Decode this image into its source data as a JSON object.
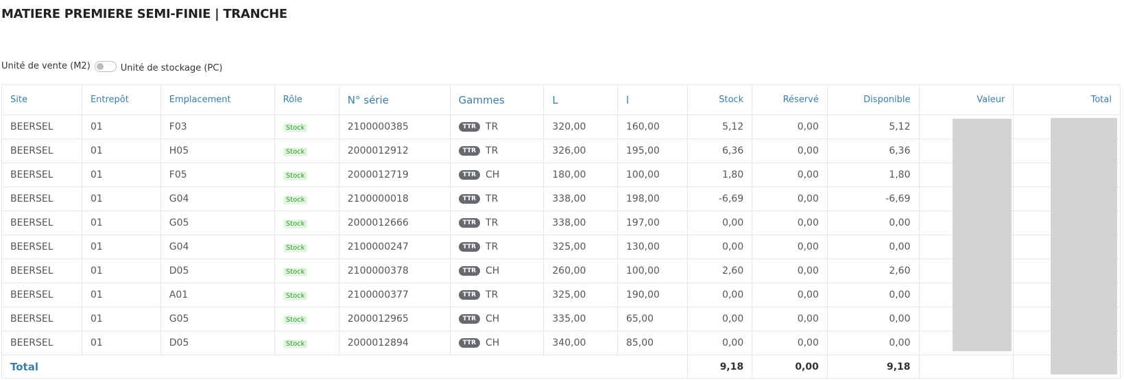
{
  "title": "MATIERE PREMIERE SEMI-FINIE | TRANCHE",
  "unit_toggle": {
    "left_label": "Unité de vente (M2)",
    "right_label": "Unité de stockage (PC)"
  },
  "table": {
    "headers": {
      "site": "Site",
      "entrepot": "Entrepôt",
      "emplacement": "Emplacement",
      "role": "Rôle",
      "serie": "N° série",
      "gammes": "Gammes",
      "L": "L",
      "l": "l",
      "stock": "Stock",
      "reserve": "Réservé",
      "disponible": "Disponible",
      "valeur": "Valeur",
      "total": "Total"
    },
    "rows": [
      {
        "site": "BEERSEL",
        "entrepot": "01",
        "emplacement": "F03",
        "role": "Stock",
        "serie": "2100000385",
        "gamme_badge": "TTR",
        "gamme": "TR",
        "L": "320,00",
        "l": "160,00",
        "stock": "5,12",
        "reserve": "0,00",
        "disponible": "5,12"
      },
      {
        "site": "BEERSEL",
        "entrepot": "01",
        "emplacement": "H05",
        "role": "Stock",
        "serie": "2000012912",
        "gamme_badge": "TTR",
        "gamme": "TR",
        "L": "326,00",
        "l": "195,00",
        "stock": "6,36",
        "reserve": "0,00",
        "disponible": "6,36"
      },
      {
        "site": "BEERSEL",
        "entrepot": "01",
        "emplacement": "F05",
        "role": "Stock",
        "serie": "2000012719",
        "gamme_badge": "TTR",
        "gamme": "CH",
        "L": "180,00",
        "l": "100,00",
        "stock": "1,80",
        "reserve": "0,00",
        "disponible": "1,80"
      },
      {
        "site": "BEERSEL",
        "entrepot": "01",
        "emplacement": "G04",
        "role": "Stock",
        "serie": "2100000018",
        "gamme_badge": "TTR",
        "gamme": "TR",
        "L": "338,00",
        "l": "198,00",
        "stock": "-6,69",
        "reserve": "0,00",
        "disponible": "-6,69"
      },
      {
        "site": "BEERSEL",
        "entrepot": "01",
        "emplacement": "G05",
        "role": "Stock",
        "serie": "2000012666",
        "gamme_badge": "TTR",
        "gamme": "TR",
        "L": "338,00",
        "l": "197,00",
        "stock": "0,00",
        "reserve": "0,00",
        "disponible": "0,00"
      },
      {
        "site": "BEERSEL",
        "entrepot": "01",
        "emplacement": "G04",
        "role": "Stock",
        "serie": "2100000247",
        "gamme_badge": "TTR",
        "gamme": "TR",
        "L": "325,00",
        "l": "130,00",
        "stock": "0,00",
        "reserve": "0,00",
        "disponible": "0,00"
      },
      {
        "site": "BEERSEL",
        "entrepot": "01",
        "emplacement": "D05",
        "role": "Stock",
        "serie": "2100000378",
        "gamme_badge": "TTR",
        "gamme": "CH",
        "L": "260,00",
        "l": "100,00",
        "stock": "2,60",
        "reserve": "0,00",
        "disponible": "2,60"
      },
      {
        "site": "BEERSEL",
        "entrepot": "01",
        "emplacement": "A01",
        "role": "Stock",
        "serie": "2100000377",
        "gamme_badge": "TTR",
        "gamme": "TR",
        "L": "325,00",
        "l": "190,00",
        "stock": "0,00",
        "reserve": "0,00",
        "disponible": "0,00"
      },
      {
        "site": "BEERSEL",
        "entrepot": "01",
        "emplacement": "G05",
        "role": "Stock",
        "serie": "2000012965",
        "gamme_badge": "TTR",
        "gamme": "CH",
        "L": "335,00",
        "l": "65,00",
        "stock": "0,00",
        "reserve": "0,00",
        "disponible": "0,00"
      },
      {
        "site": "BEERSEL",
        "entrepot": "01",
        "emplacement": "D05",
        "role": "Stock",
        "serie": "2000012894",
        "gamme_badge": "TTR",
        "gamme": "CH",
        "L": "340,00",
        "l": "85,00",
        "stock": "0,00",
        "reserve": "0,00",
        "disponible": "0,00"
      }
    ],
    "totals": {
      "label": "Total",
      "stock": "9,18",
      "reserve": "0,00",
      "disponible": "9,18"
    }
  },
  "colors": {
    "header_text": "#3a7ea6",
    "stock_badge_bg": "#e4f6e2",
    "stock_badge_text": "#2e9a2e",
    "ttr_badge_bg": "#666a70",
    "masked": "#d3d3d3"
  }
}
